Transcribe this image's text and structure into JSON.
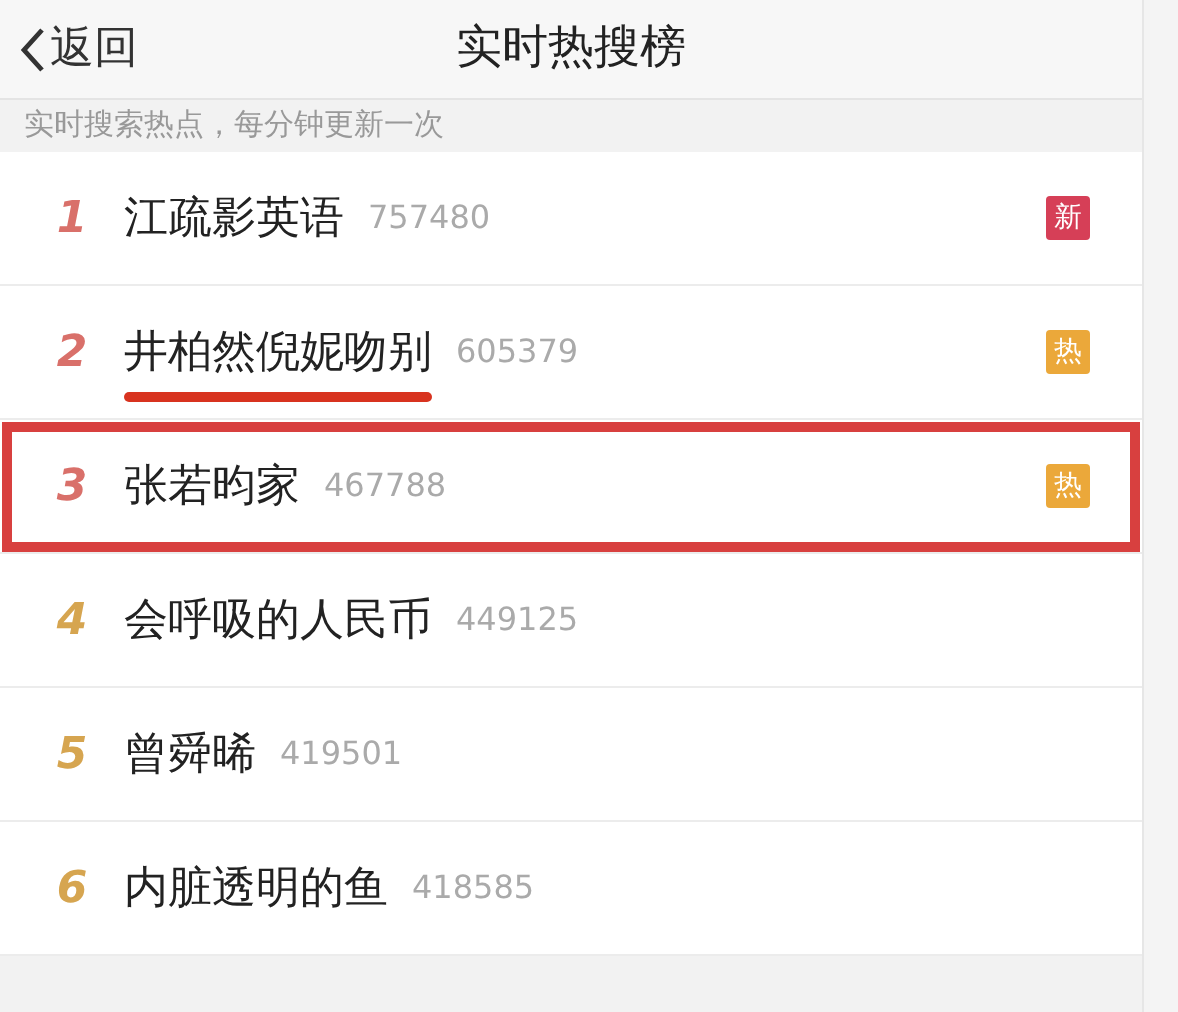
{
  "header": {
    "back_label": "返回",
    "title": "实时热搜榜"
  },
  "subtitle": "实时搜索热点，每分钟更新一次",
  "items": [
    {
      "rank": "1",
      "color": "#d9706a",
      "topic": "江疏影英语",
      "count": "757480",
      "badge": {
        "kind": "new",
        "text": "新"
      },
      "underlined": false,
      "framed": false
    },
    {
      "rank": "2",
      "color": "#d9706a",
      "topic": "井柏然倪妮吻别",
      "count": "605379",
      "badge": {
        "kind": "hot",
        "text": "热"
      },
      "underlined": true,
      "framed": false
    },
    {
      "rank": "3",
      "color": "#d9706a",
      "topic": "张若昀家",
      "count": "467788",
      "badge": {
        "kind": "hot",
        "text": "热"
      },
      "underlined": false,
      "framed": true
    },
    {
      "rank": "4",
      "color": "#d6a550",
      "topic": "会呼吸的人民币",
      "count": "449125",
      "underlined": false,
      "framed": false
    },
    {
      "rank": "5",
      "color": "#d6a550",
      "topic": "曾舜晞",
      "count": "419501",
      "underlined": false,
      "framed": false
    },
    {
      "rank": "6",
      "color": "#d6a550",
      "topic": "内脏透明的鱼",
      "count": "418585",
      "underlined": false,
      "framed": false
    }
  ]
}
